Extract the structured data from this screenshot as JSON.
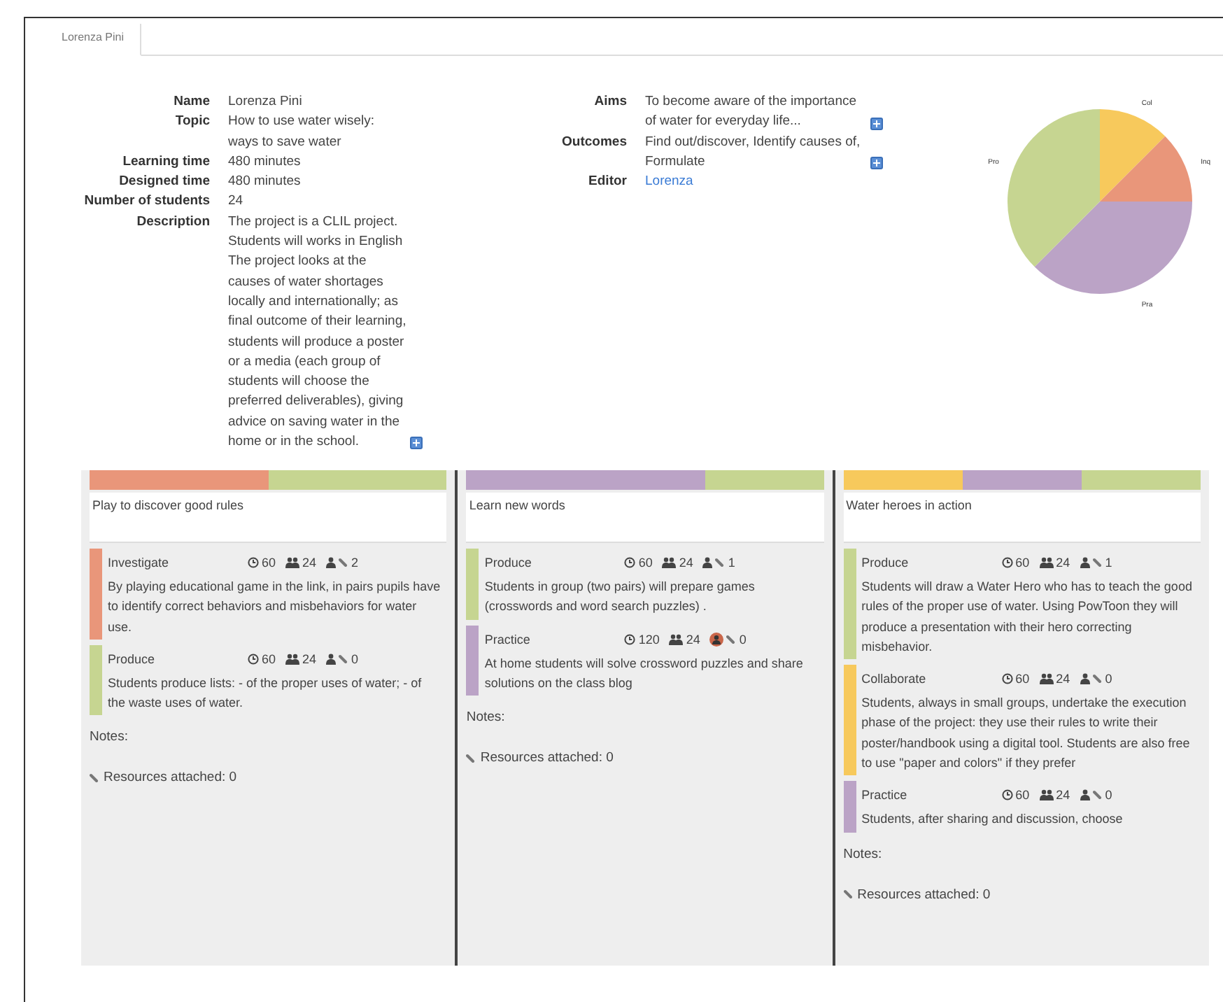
{
  "tabs": [
    {
      "label": "Lorenza Pini",
      "selected": true
    }
  ],
  "info_left": [
    {
      "label": "Name",
      "value": "Lorenza Pini"
    },
    {
      "label": "Topic",
      "value": "How to use water wisely: ways to save water"
    },
    {
      "label": "Learning time",
      "value": "480 minutes"
    },
    {
      "label": "Designed time",
      "value": "480 minutes"
    },
    {
      "label": "Number of students",
      "value": "24"
    },
    {
      "label": "Description",
      "value": "The project is a CLIL project. Students will works in English The project looks at the causes of water shortages locally and internationally; as final outcome of their learning, students will produce a poster or a media (each group of students will choose the preferred deliverables), giving advice on saving water in the home or in the school.",
      "expand": true
    }
  ],
  "info_right": [
    {
      "label": "Aims",
      "value": "To become aware of the importance of water for everyday life...",
      "expand": true
    },
    {
      "label": "Outcomes",
      "value": "Find out/discover, Identify causes of, Formulate",
      "expand": true
    },
    {
      "label": "Editor",
      "value": "Lorenza",
      "link": true
    }
  ],
  "chart_data": {
    "type": "pie",
    "categories": [
      "Col",
      "Inq",
      "Pra",
      "Pro"
    ],
    "series": [
      {
        "values": [
          12.5,
          12.5,
          37.5,
          37.5
        ]
      }
    ],
    "colors": [
      "#f7c95c",
      "#e9967a",
      "#bba3c6",
      "#c6d591"
    ]
  },
  "columns": [
    {
      "title": "Play to discover good rules",
      "activities": [
        {
          "kind": "investigate",
          "name": "Investigate",
          "minutes": "60",
          "students": "24",
          "person_alert": false,
          "resources": "2",
          "description": "By playing educational game in the link, in pairs pupils have to identify correct behaviors and misbehaviors for water use."
        },
        {
          "kind": "produce",
          "name": "Produce",
          "minutes": "60",
          "students": "24",
          "person_alert": false,
          "resources": "0",
          "description": "Students produce lists: - of the proper uses of water; - of the waste uses of water."
        }
      ],
      "notes": "Notes:",
      "resources": "Resources attached: 0"
    },
    {
      "title": "Learn new words",
      "activities": [
        {
          "kind": "produce",
          "name": "Produce",
          "minutes": "60",
          "students": "24",
          "person_alert": false,
          "resources": "1",
          "description": "Students in group (two pairs) will prepare games (crosswords and word search puzzles) ."
        },
        {
          "kind": "practice",
          "name": "Practice",
          "minutes": "120",
          "students": "24",
          "person_alert": true,
          "resources": "0",
          "description": "At home students will solve crossword puzzles and share solutions on the class blog"
        }
      ],
      "notes": "Notes:",
      "resources": "Resources attached: 0"
    },
    {
      "title": "Water heroes in action",
      "activities": [
        {
          "kind": "produce",
          "name": "Produce",
          "minutes": "60",
          "students": "24",
          "person_alert": false,
          "resources": "1",
          "description": "Students will draw a Water Hero who has to teach the good rules of the proper use of water. Using PowToon they will produce a presentation with their hero correcting misbehavior."
        },
        {
          "kind": "collaborate",
          "name": "Collaborate",
          "minutes": "60",
          "students": "24",
          "person_alert": false,
          "resources": "0",
          "description": "Students, always in small groups, undertake the execution phase of the project: they use their rules to write their poster/handbook using a digital tool. Students are also free to use \"paper and colors\" if they prefer"
        },
        {
          "kind": "practice",
          "name": "Practice",
          "minutes": "60",
          "students": "24",
          "person_alert": false,
          "resources": "0",
          "description": "Students, after sharing and discussion, choose"
        }
      ],
      "notes": "Notes:",
      "resources": "Resources attached: 0"
    }
  ]
}
